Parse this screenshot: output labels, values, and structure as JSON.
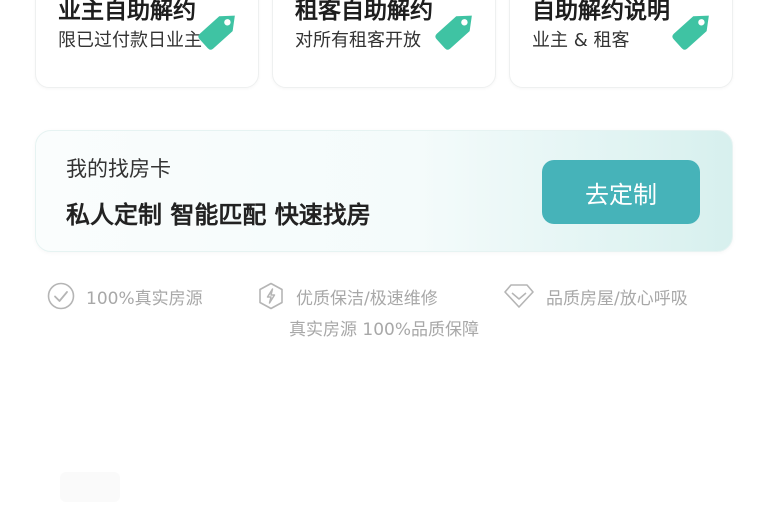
{
  "cards": [
    {
      "title": "业主自助解约",
      "subtitle": "限已过付款日业主",
      "icon": "tag-icon"
    },
    {
      "title": "租客自助解约",
      "subtitle": "对所有租客开放",
      "icon": "tag-icon"
    },
    {
      "title": "自助解约说明",
      "subtitle": "业主 & 租客",
      "icon": "tag-icon"
    }
  ],
  "finder": {
    "label": "我的找房卡",
    "slogan": "私人定制 智能匹配 快速找房",
    "button": "去定制"
  },
  "features": [
    {
      "text": "100%真实房源",
      "icon": "check-circle-icon"
    },
    {
      "text": "优质保洁/极速维修",
      "icon": "lightning-shield-icon"
    },
    {
      "text": "品质房屋/放心呼吸",
      "icon": "diamond-icon"
    }
  ],
  "guarantee": "真实房源 100%品质保障",
  "colors": {
    "accent": "#46b3b9",
    "tag": "#3fc3a3",
    "muted": "#a8a8a8"
  }
}
